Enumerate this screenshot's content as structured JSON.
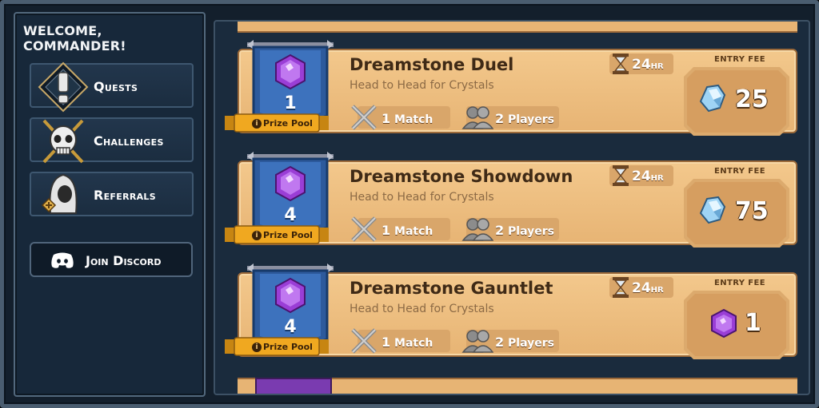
{
  "sidebar": {
    "welcome": "WELCOME, COMMANDER!",
    "items": [
      {
        "label": "Quests",
        "icon": "exclamation-icon"
      },
      {
        "label": "Challenges",
        "icon": "skull-swords-icon"
      },
      {
        "label": "Referrals",
        "icon": "hooded-figure-icon"
      }
    ],
    "discord": {
      "label": "Join Discord",
      "icon": "discord-icon"
    }
  },
  "cards": [
    {
      "title": "Dreamstone Duel",
      "subtitle": "Head to Head for Crystals",
      "prize_pool_count": "1",
      "prize_pool_label": "Prize Pool",
      "matches_num": "1",
      "matches_label": "Match",
      "players_num": "2",
      "players_label": "Players",
      "timer_num": "24",
      "timer_unit": "HR",
      "entry_fee_label": "ENTRY FEE",
      "entry_fee_value": "25",
      "entry_fee_icon": "crystal-icon"
    },
    {
      "title": "Dreamstone Showdown",
      "subtitle": "Head to Head for Crystals",
      "prize_pool_count": "4",
      "prize_pool_label": "Prize Pool",
      "matches_num": "1",
      "matches_label": "Match",
      "players_num": "2",
      "players_label": "Players",
      "timer_num": "24",
      "timer_unit": "HR",
      "entry_fee_label": "ENTRY FEE",
      "entry_fee_value": "75",
      "entry_fee_icon": "crystal-icon"
    },
    {
      "title": "Dreamstone Gauntlet",
      "subtitle": "Head to Head for Crystals",
      "prize_pool_count": "4",
      "prize_pool_label": "Prize Pool",
      "matches_num": "1",
      "matches_label": "Match",
      "players_num": "2",
      "players_label": "Players",
      "timer_num": "24",
      "timer_unit": "HR",
      "entry_fee_label": "ENTRY FEE",
      "entry_fee_value": "1",
      "entry_fee_icon": "dreamstone-gem-icon"
    }
  ],
  "colors": {
    "panel_bg": "#17283a",
    "parchment": "#f3c88c",
    "banner_blue": "#2d5a9c",
    "gem_purple": "#9a3ed6",
    "ribbon_gold": "#f0a820"
  }
}
